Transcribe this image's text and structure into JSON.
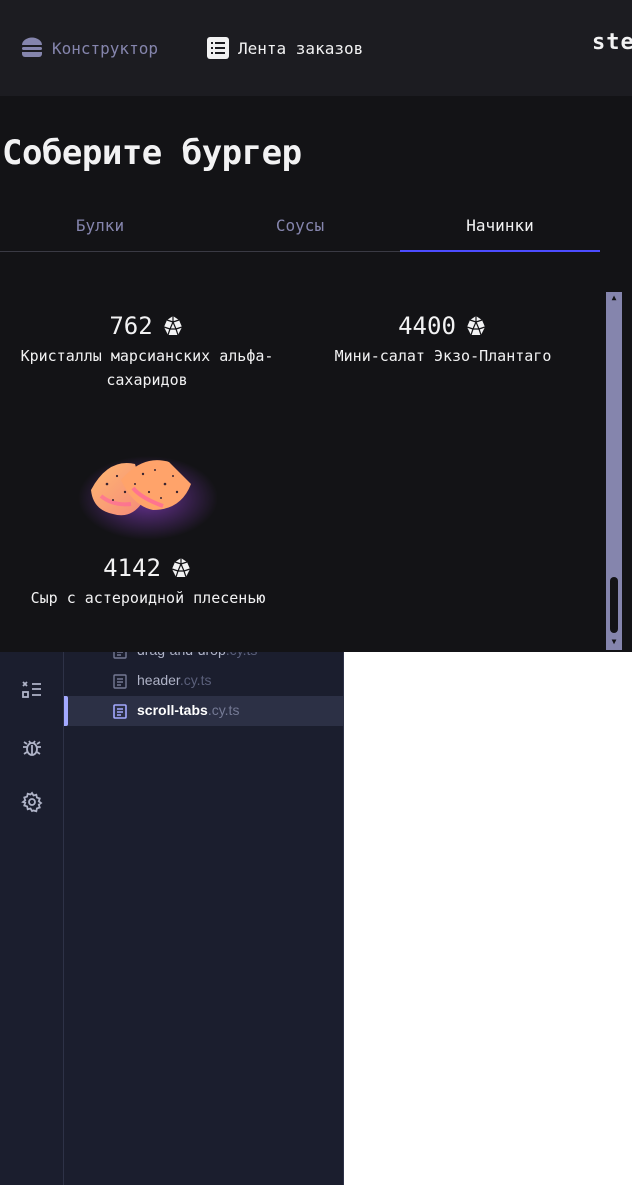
{
  "header": {
    "nav": [
      {
        "label": "Конструктор",
        "icon": "burger-icon"
      },
      {
        "label": "Лента заказов",
        "icon": "list-icon"
      }
    ],
    "logo": "ste"
  },
  "main": {
    "title": "Соберите бургер",
    "tabs": [
      {
        "label": "Булки",
        "active": false
      },
      {
        "label": "Соусы",
        "active": false
      },
      {
        "label": "Начинки",
        "active": true
      }
    ],
    "ingredients": [
      {
        "price": "762",
        "name": "Кристаллы марсианских альфа-сахаридов"
      },
      {
        "price": "4400",
        "name": "Мини-салат Экзо-Плантаго"
      },
      {
        "price": "4142",
        "name": "Сыр с астероидной плесенью"
      }
    ],
    "scroll_position": 0.95
  },
  "runner": {
    "sidebar_icons": [
      "specs-list-icon",
      "debug-bug-icon",
      "settings-gear-icon"
    ],
    "specs": [
      {
        "name": "drag-and-drop",
        "ext": ".cy.ts",
        "active": false
      },
      {
        "name": "header",
        "ext": ".cy.ts",
        "active": false
      },
      {
        "name": "scroll-tabs",
        "ext": ".cy.ts",
        "active": true
      }
    ]
  },
  "colors": {
    "app_bg": "#131316",
    "header_bg": "#1c1c21",
    "accent": "#4c4cff",
    "inactive_text": "#8585ad",
    "runner_bg": "#1b1e2e",
    "runner_active": "#a3a9ff"
  }
}
